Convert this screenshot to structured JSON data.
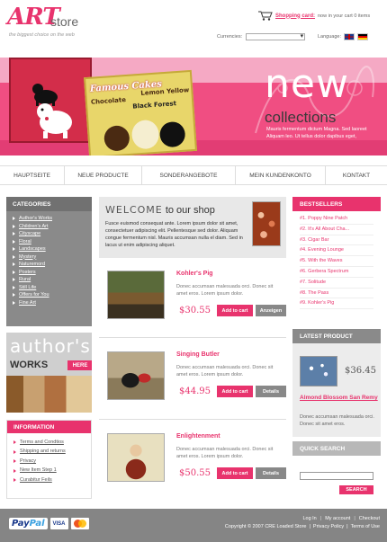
{
  "header": {
    "logo_art": "ART",
    "logo_store": "store",
    "tagline": "the biggest choice on the web",
    "cart_link": "Shopping card:",
    "cart_status": "now in your cart 0 items",
    "currencies_label": "Currencies:",
    "currency_value": "",
    "language_label": "Language:"
  },
  "banner": {
    "poster_title": "Famous Cakes",
    "poster_chocolate": "Chocolate",
    "poster_lemon": "Lemon Yellow",
    "poster_black": "Black Forest",
    "headline": "new",
    "subheadline": "collections",
    "text": "Mauris fermentum dictum Magna. Sed laoreet Aliquam leo. Ut tellus dolor dapibus eget,"
  },
  "nav": [
    {
      "label": "HAUPTSEITE"
    },
    {
      "label": "NEUE PRODUCTE"
    },
    {
      "label": "SONDERANGEBOTE"
    },
    {
      "label": "MEIN KUNDENKONTO"
    },
    {
      "label": "KONTAKT"
    }
  ],
  "categories": {
    "title": "CATEGORIES",
    "items": [
      "Author's Works",
      "Children's Art",
      "Cityscape",
      "Floral",
      "Landscapes",
      "Mystery",
      "Naturemord",
      "Posters",
      "Rural",
      "Still Life",
      "Offers for You",
      "Fine Art"
    ]
  },
  "authors_banner": {
    "word": "author's",
    "works": "WORKS",
    "here": "HERE"
  },
  "information": {
    "title": "INFORMATION",
    "items": [
      "Terms and Condtios",
      "Shipping and returns",
      "Privacy",
      "New Item Step 1",
      "Curabitur Feils"
    ]
  },
  "welcome": {
    "title_word": "WELCOME",
    "title_rest": "to our shop",
    "text": "Fusce euismod consequat ante. Lorem ipsum dolor sit amet, consectetuer adipiscing elit. Pellentesque sed dolor. Aliquam congue fermentum nisl. Mauris accumsan nulla el diam. Sed in lacus ut enim adipiscing aliquet."
  },
  "products": [
    {
      "name": "Kohler's Pig",
      "desc": "Donec accumsan malesuada orci. Donec sit amet eros. Lorem ipsum dolor.",
      "price": "$30.55",
      "cart": "Add to cart",
      "details": "Anzeigen"
    },
    {
      "name": "Singing Butler",
      "desc": "Donec accumsan malesuada orci. Donec sit amet eros. Lorem ipsum dolor.",
      "price": "$44.95",
      "cart": "Add to cart",
      "details": "Details"
    },
    {
      "name": "Enlightenment",
      "desc": "Donec accumsan malesuada orci. Donec sit amet eros. Lorem ipsum dolor.",
      "price": "$50.55",
      "cart": "Add to cart",
      "details": "Details"
    }
  ],
  "bestsellers": {
    "title": "BESTSELLERS",
    "items": [
      "#1. Poppy Nine Patch",
      "#2. It's All About Cha...",
      "#3. Cigar Bar",
      "#4. Evening Lounge",
      "#5. With the Waves",
      "#6. Gerbera Spectrum",
      "#7. Solitude",
      "#8. The Pass",
      "#9. Kohler's Pig"
    ]
  },
  "latest": {
    "title": "LATEST PRODUCT",
    "price": "$36.45",
    "name": "Almond Blossom San Remy",
    "desc": "Donec accumsan malesuada orci. Donec sit amet eros."
  },
  "search": {
    "title": "QUICK SEARCH",
    "button": "SEARCH",
    "placeholder": ""
  },
  "footer": {
    "paypal_a": "Pay",
    "paypal_b": "Pal",
    "visa": "VISA",
    "login": "Log In",
    "account": "My account",
    "checkout": "Checkout",
    "copyright": "Copyright © 2007 CRE Loaded Store",
    "privacy": "Privacy Policy",
    "terms": "Terms of Use"
  },
  "colors": {
    "accent": "#e8336d",
    "gray_box": "#8a8a8a",
    "footer": "#858585"
  }
}
